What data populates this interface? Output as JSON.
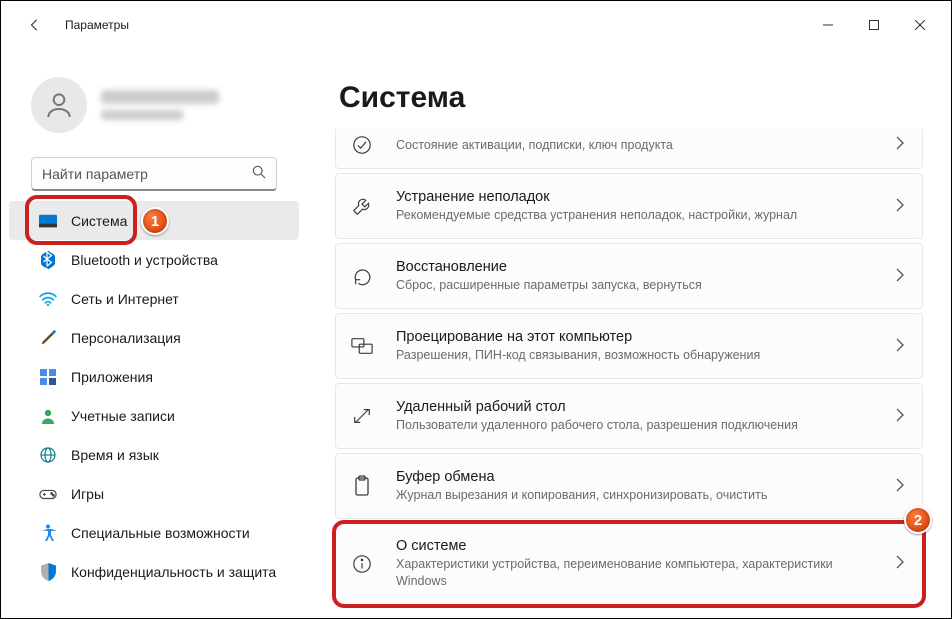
{
  "window": {
    "title": "Параметры"
  },
  "search": {
    "placeholder": "Найти параметр"
  },
  "nav": [
    {
      "label": "Система",
      "selected": true,
      "icon": "system"
    },
    {
      "label": "Bluetooth и устройства",
      "icon": "bluetooth"
    },
    {
      "label": "Сеть и Интернет",
      "icon": "wifi"
    },
    {
      "label": "Персонализация",
      "icon": "brush"
    },
    {
      "label": "Приложения",
      "icon": "apps"
    },
    {
      "label": "Учетные записи",
      "icon": "person"
    },
    {
      "label": "Время и язык",
      "icon": "globe"
    },
    {
      "label": "Игры",
      "icon": "games"
    },
    {
      "label": "Специальные возможности",
      "icon": "access"
    },
    {
      "label": "Конфиденциальность и защита",
      "icon": "shield"
    }
  ],
  "page_title": "Система",
  "cards": [
    {
      "title": "",
      "sub": "Состояние активации, подписки, ключ продукта",
      "icon": "activation",
      "partial_top": true
    },
    {
      "title": "Устранение неполадок",
      "sub": "Рекомендуемые средства устранения неполадок, настройки, журнал",
      "icon": "troubleshoot"
    },
    {
      "title": "Восстановление",
      "sub": "Сброс, расширенные параметры запуска, вернуться",
      "icon": "recovery"
    },
    {
      "title": "Проецирование на этот компьютер",
      "sub": "Разрешения, ПИН-код связывания, возможность обнаружения",
      "icon": "project"
    },
    {
      "title": "Удаленный рабочий стол",
      "sub": "Пользователи удаленного рабочего стола, разрешения подключения",
      "icon": "remote"
    },
    {
      "title": "Буфер обмена",
      "sub": "Журнал вырезания и копирования, синхронизировать, очистить",
      "icon": "clipboard"
    },
    {
      "title": "О системе",
      "sub": "Характеристики устройства, переименование компьютера, характеристики Windows",
      "icon": "about",
      "highlight": true
    }
  ],
  "badges": {
    "nav": "1",
    "card": "2"
  }
}
